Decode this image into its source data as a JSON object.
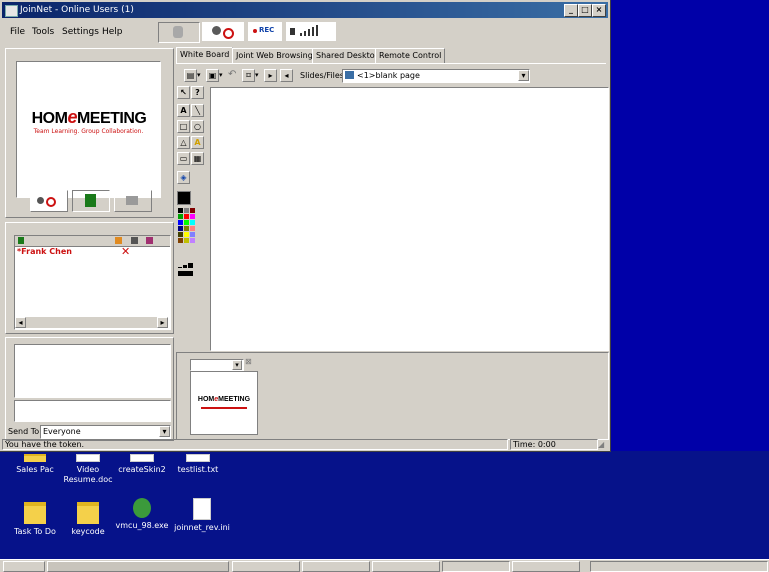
{
  "window": {
    "title": "JoinNet - Online Users (1)",
    "caption_buttons": [
      "_",
      "□",
      "×"
    ]
  },
  "menu": [
    "File",
    "Tools",
    "Settings",
    "Help"
  ],
  "toolbar": {
    "rec_label": "REC"
  },
  "logo": {
    "line1_a": "HOM",
    "line1_e": "e",
    "line1_b": "MEETING",
    "tagline": "Team Learning.  Group Collaboration."
  },
  "tabs": [
    "White Board",
    "Joint Web Browsing",
    "Shared Desktop",
    "Remote Control"
  ],
  "whiteboard": {
    "slides_label": "Slides/Files:",
    "slides_value": "<1>blank page"
  },
  "users": {
    "selected_name": "*Frank Chen"
  },
  "chat": {
    "send_to_label": "Send To:",
    "send_to_value": "Everyone"
  },
  "status": {
    "message": "You have the token.",
    "time": "Time: 0:00"
  },
  "desktop_icons": [
    {
      "label": "Sales Pac"
    },
    {
      "label": "Video Resume.doc"
    },
    {
      "label": "createSkin2"
    },
    {
      "label": "testlist.txt"
    },
    {
      "label": "Task To Do"
    },
    {
      "label": "keycode"
    },
    {
      "label": "vmcu_98.exe"
    },
    {
      "label": "joinnet_rev.ini"
    }
  ],
  "colors": {
    "accent_red": "#cc1111",
    "title_blue": "#0a246a",
    "desktop_blue": "#0a1a8a"
  }
}
